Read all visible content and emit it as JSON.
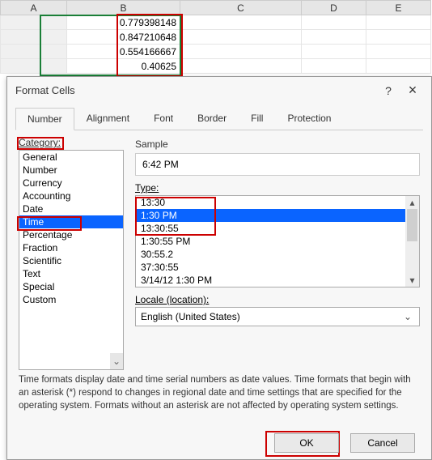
{
  "spreadsheet": {
    "columns": [
      "A",
      "B",
      "C",
      "D",
      "E"
    ],
    "cells": {
      "b1": "0.779398148",
      "b2": "0.847210648",
      "b3": "0.554166667",
      "b4": "0.40625"
    }
  },
  "dialog": {
    "title": "Format Cells",
    "help": "?",
    "close": "×",
    "tabs": {
      "number": "Number",
      "alignment": "Alignment",
      "font": "Font",
      "border": "Border",
      "fill": "Fill",
      "protection": "Protection"
    },
    "category_label": "Category:",
    "categories": [
      "General",
      "Number",
      "Currency",
      "Accounting",
      "Date",
      "Time",
      "Percentage",
      "Fraction",
      "Scientific",
      "Text",
      "Special",
      "Custom"
    ],
    "sample_label": "Sample",
    "sample_value": "6:42 PM",
    "type_label": "Type:",
    "types": [
      "13:30",
      "1:30 PM",
      "13:30:55",
      "1:30:55 PM",
      "30:55.2",
      "37:30:55",
      "3/14/12 1:30 PM"
    ],
    "locale_label": "Locale (location):",
    "locale_value": "English (United States)",
    "info": "Time formats display date and time serial numbers as date values.  Time formats that begin with an asterisk (*) respond to changes in regional date and time settings that are specified for the operating system. Formats without an asterisk are not affected by operating system settings.",
    "ok": "OK",
    "cancel": "Cancel",
    "scroll_down": "⌄",
    "dropdown_arrow": "⌄",
    "arrow_up": "▴",
    "arrow_down": "▾"
  }
}
